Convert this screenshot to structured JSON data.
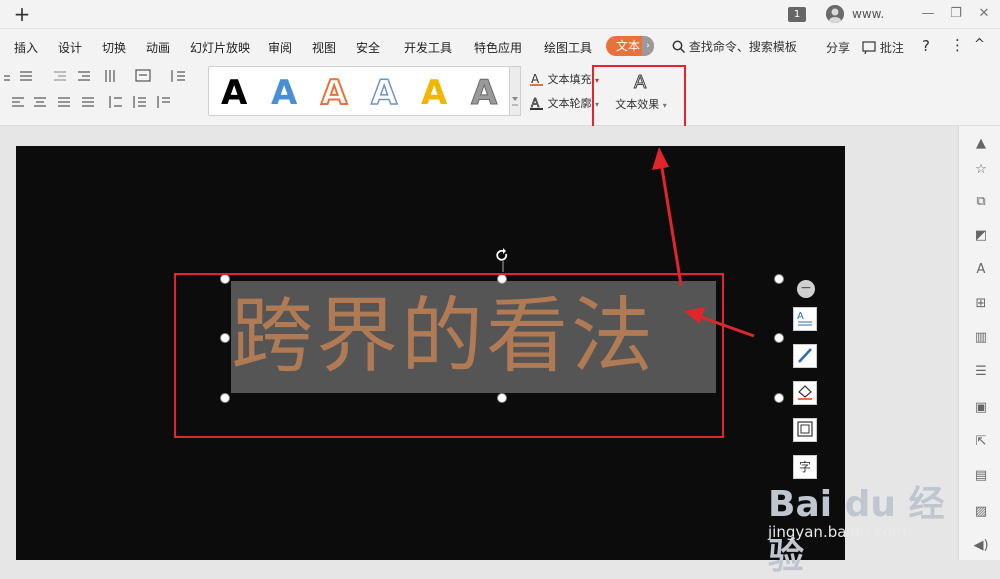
{
  "titlebar": {
    "add_tab": "+",
    "tab_count": "1",
    "user": "www.",
    "minimize": "—",
    "restore": "❐",
    "close": "✕"
  },
  "menu": {
    "items": [
      "插入",
      "设计",
      "切换",
      "动画",
      "幻灯片放映",
      "审阅",
      "视图",
      "安全",
      "开发工具",
      "特色应用",
      "绘图工具"
    ],
    "active": "文本",
    "active_chevron": "›",
    "search": "查找命令、搜索模板",
    "share": "分享",
    "comment": "批注",
    "help": "?",
    "more": "⋮",
    "collapse": "^"
  },
  "ribbon": {
    "style_letter": "A",
    "styles": [
      {
        "fill": "#000000",
        "stroke": "#000000",
        "style": "solid"
      },
      {
        "fill": "#4a8fd6",
        "stroke": "#4a8fd6",
        "style": "solid"
      },
      {
        "fill": "#ffffff",
        "stroke": "#e9723b",
        "style": "outline-orange"
      },
      {
        "fill": "#ffffff",
        "stroke": "#6f94c8",
        "style": "outline-blue"
      },
      {
        "fill": "#f2b600",
        "stroke": "#f2b600",
        "style": "solid"
      },
      {
        "fill": "#8c8c8c",
        "stroke": "#6a6a6a",
        "style": "gradient-gray"
      }
    ],
    "text_fill": "文本填充",
    "text_outline": "文本轮廓",
    "text_effect": "文本效果"
  },
  "slide": {
    "text": "跨界的看法",
    "text_color": "#b07a55",
    "selection_bg": "#555555",
    "background": "#0c0c0c"
  },
  "floating_tools": [
    "minus",
    "text-style",
    "brush",
    "fill",
    "border",
    "字"
  ],
  "float_labels": {
    "text_style": "A",
    "char": "字"
  },
  "watermark": {
    "logo": "Bai du 经验",
    "url": "jingyan.baidu.com"
  },
  "colors": {
    "accent": "#e9723b",
    "highlight_red": "#e0262a"
  }
}
